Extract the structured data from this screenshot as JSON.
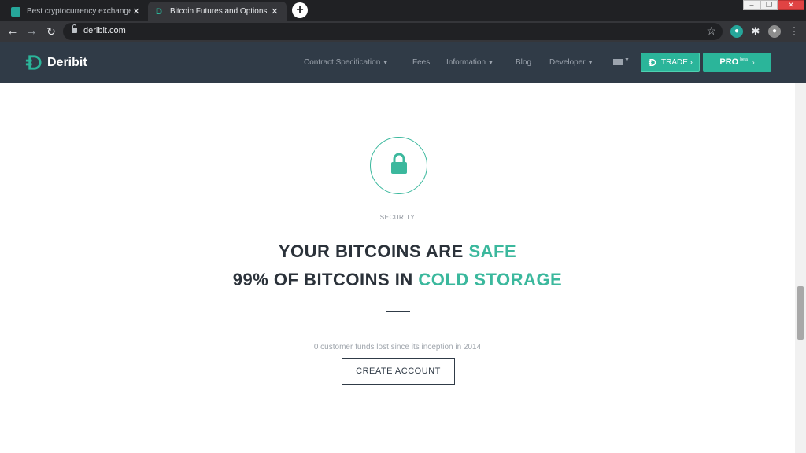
{
  "browser": {
    "tabs": [
      {
        "title": "Best cryptocurrency exchanges",
        "close": "✕",
        "active": false
      },
      {
        "title": "Bitcoin Futures and Options Exch",
        "close": "✕",
        "active": true
      }
    ],
    "new_tab": "+",
    "address": "deribit.com",
    "window_controls": {
      "minimize": "–",
      "maximize": "❐",
      "close": "✕"
    }
  },
  "site": {
    "logo_text": "Deribit",
    "nav": [
      {
        "label": "Contract Specification",
        "has_dropdown": true
      },
      {
        "label": "Fees",
        "has_dropdown": false
      },
      {
        "label": "Information",
        "has_dropdown": true
      },
      {
        "label": "Blog",
        "has_dropdown": false
      },
      {
        "label": "Developer",
        "has_dropdown": true
      }
    ],
    "trade_button": "TRADE ›",
    "pro_button": {
      "label": "PRO",
      "badge": "beta",
      "arrow": "›"
    }
  },
  "hero": {
    "icon": "lock-icon",
    "section_label": "SECURITY",
    "line1_prefix": "YOUR BITCOINS ARE ",
    "line1_accent": "SAFE",
    "line2_prefix": "99% OF BITCOINS IN ",
    "line2_accent": "COLD STORAGE",
    "subtext": "0 customer funds lost since its inception in 2014",
    "cta": "CREATE ACCOUNT"
  },
  "colors": {
    "brand_dark": "#303b47",
    "accent": "#3bb89d",
    "button_green": "#2bb59a"
  }
}
